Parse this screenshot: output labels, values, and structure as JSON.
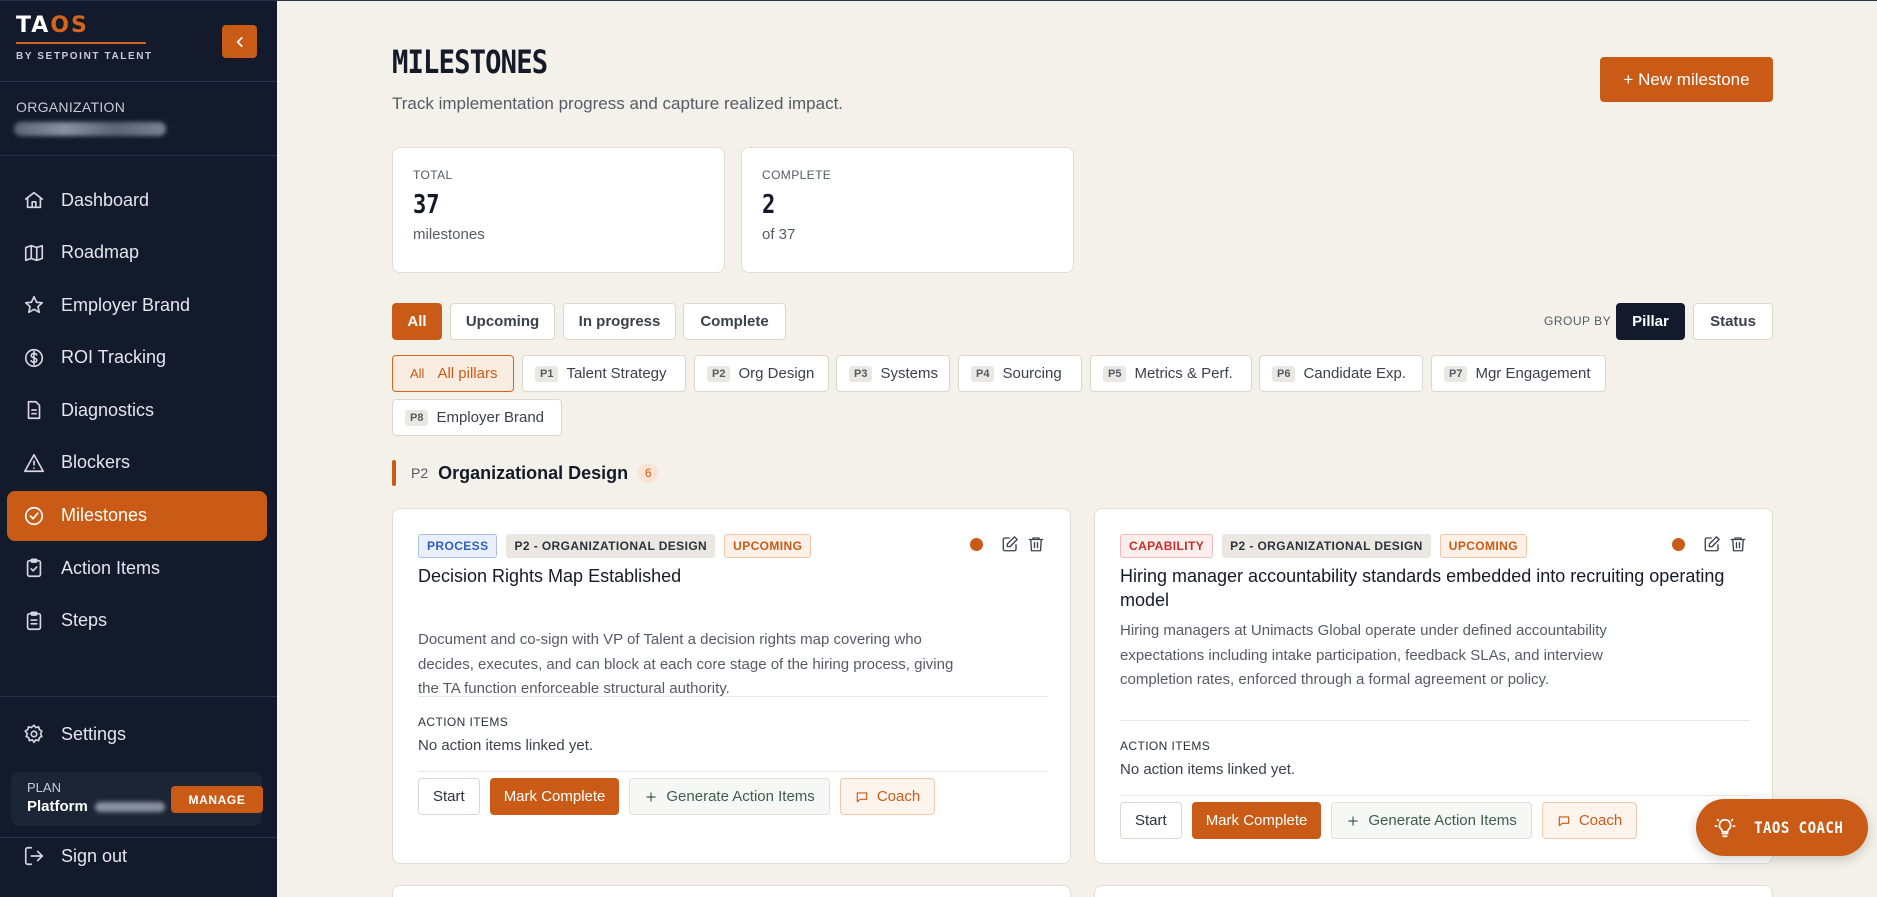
{
  "brand": {
    "logo_a": "TA",
    "logo_b": "OS",
    "tagline": "BY SETPOINT TALENT"
  },
  "sidebar": {
    "org_label": "ORGANIZATION",
    "items": [
      {
        "label": "Dashboard",
        "icon": "home-icon"
      },
      {
        "label": "Roadmap",
        "icon": "map-icon"
      },
      {
        "label": "Employer Brand",
        "icon": "star-icon"
      },
      {
        "label": "ROI Tracking",
        "icon": "dollar-icon"
      },
      {
        "label": "Diagnostics",
        "icon": "document-icon"
      },
      {
        "label": "Blockers",
        "icon": "warning-icon"
      },
      {
        "label": "Milestones",
        "icon": "check-circle-icon",
        "active": true
      },
      {
        "label": "Action Items",
        "icon": "clipboard-check-icon"
      },
      {
        "label": "Steps",
        "icon": "clipboard-list-icon"
      }
    ],
    "settings_label": "Settings",
    "plan_label": "PLAN",
    "plan_name": "Platform",
    "manage_label": "MANAGE",
    "signout_label": "Sign out"
  },
  "header": {
    "title": "MILESTONES",
    "subtitle": "Track implementation progress and capture realized impact.",
    "new_button": "+ New milestone"
  },
  "stats": [
    {
      "label": "TOTAL",
      "value": "37",
      "sub": "milestones"
    },
    {
      "label": "COMPLETE",
      "value": "2",
      "sub": "of 37"
    }
  ],
  "status_filters": [
    "All",
    "Upcoming",
    "In progress",
    "Complete"
  ],
  "group_by": {
    "label": "GROUP BY",
    "options": [
      "Pillar",
      "Status"
    ],
    "active": "Pillar"
  },
  "pillars": [
    {
      "code": "All",
      "label": "All pillars",
      "active": true
    },
    {
      "code": "P1",
      "label": "Talent Strategy"
    },
    {
      "code": "P2",
      "label": "Org Design"
    },
    {
      "code": "P3",
      "label": "Systems"
    },
    {
      "code": "P4",
      "label": "Sourcing"
    },
    {
      "code": "P5",
      "label": "Metrics & Perf."
    },
    {
      "code": "P6",
      "label": "Candidate Exp."
    },
    {
      "code": "P7",
      "label": "Mgr Engagement"
    },
    {
      "code": "P8",
      "label": "Employer Brand"
    }
  ],
  "section": {
    "code": "P2",
    "title": "Organizational Design",
    "count": "6"
  },
  "cards": [
    {
      "type_tag": "PROCESS",
      "pillar_tag": "P2 - ORGANIZATIONAL DESIGN",
      "status_tag": "UPCOMING",
      "title": "Decision Rights Map Established",
      "description": "Document and co-sign with VP of Talent a decision rights map covering who decides, executes, and can block at each core stage of the hiring process, giving the TA function enforceable structural authority.",
      "action_items_label": "ACTION ITEMS",
      "action_items_empty": "No action items linked yet.",
      "buttons": {
        "start": "Start",
        "complete": "Mark Complete",
        "generate": "Generate Action Items",
        "coach": "Coach"
      }
    },
    {
      "type_tag": "CAPABILITY",
      "pillar_tag": "P2 - ORGANIZATIONAL DESIGN",
      "status_tag": "UPCOMING",
      "title": "Hiring manager accountability standards embedded into recruiting operating model",
      "description": "Hiring managers at Unimacts Global operate under defined accountability expectations including intake participation, feedback SLAs, and interview completion rates, enforced through a formal agreement or policy.",
      "action_items_label": "ACTION ITEMS",
      "action_items_empty": "No action items linked yet.",
      "buttons": {
        "start": "Start",
        "complete": "Mark Complete",
        "generate": "Generate Action Items",
        "coach": "Coach"
      }
    }
  ],
  "coach_fab": "TAOS COACH",
  "colors": {
    "accent": "#c95b16",
    "sidebar_bg": "#121a2b",
    "page_bg": "#f4f1ea"
  }
}
